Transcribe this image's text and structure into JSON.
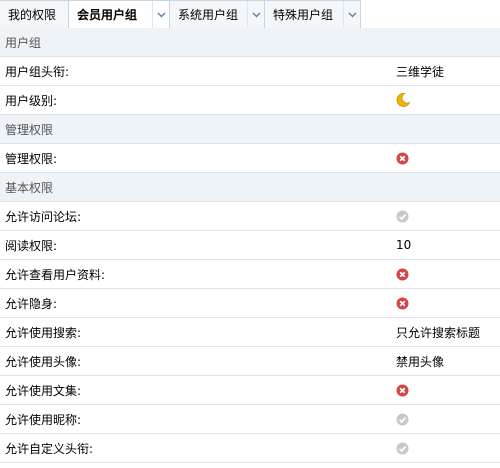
{
  "tabs": [
    {
      "label": "我的权限",
      "active": false,
      "dropdown": false
    },
    {
      "label": "会员用户组",
      "active": true,
      "dropdown": true
    },
    {
      "label": "系统用户组",
      "active": false,
      "dropdown": true
    },
    {
      "label": "特殊用户组",
      "active": false,
      "dropdown": true
    }
  ],
  "sections": {
    "user_group": "用户组",
    "admin_perms": "管理权限",
    "basic_perms": "基本权限"
  },
  "rows": {
    "group_title": {
      "label": "用户组头衔:",
      "value": "三维学徒"
    },
    "group_level": {
      "label": "用户级别:",
      "icon": "moon-icon"
    },
    "admin": {
      "label": "管理权限:",
      "icon": "deny-icon"
    },
    "visit_forum": {
      "label": "允许访问论坛:",
      "icon": "check-icon"
    },
    "read_perm": {
      "label": "阅读权限:",
      "value": "10"
    },
    "view_profile": {
      "label": "允许查看用户资料:",
      "icon": "deny-icon"
    },
    "invisible": {
      "label": "允许隐身:",
      "icon": "deny-icon"
    },
    "search": {
      "label": "允许使用搜索:",
      "value": "只允许搜索标题"
    },
    "avatar": {
      "label": "允许使用头像:",
      "value": "禁用头像"
    },
    "anthology": {
      "label": "允许使用文集:",
      "icon": "deny-icon"
    },
    "nickname": {
      "label": "允许使用昵称:",
      "icon": "check-icon"
    },
    "custom_title": {
      "label": "允许自定义头衔:",
      "icon": "check-icon"
    }
  },
  "colors": {
    "header_bg": "#eef3f7",
    "row_border": "#d9e4ee",
    "deny_red": "#d64545",
    "check_gray": "#c8c8c8",
    "moon_yellow": "#f2b400"
  }
}
